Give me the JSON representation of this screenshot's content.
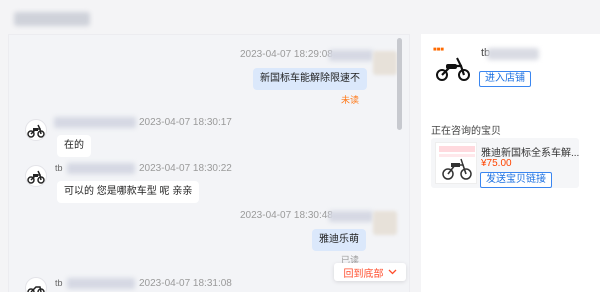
{
  "chat": {
    "messages": [
      {
        "time": "2023-04-07 18:29:08",
        "text": "新国标车能解除限速不",
        "status": "未读"
      },
      {
        "time": "2023-04-07 18:30:17",
        "text": "在的"
      },
      {
        "time": "2023-04-07 18:30:22",
        "nick_prefix": "tb",
        "text": "可以的 您是哪款车型 呢 亲亲"
      },
      {
        "time": "2023-04-07 18:30:48",
        "text": "雅迪乐萌",
        "status": "已读"
      },
      {
        "time": "2023-04-07 18:31:08",
        "nick_prefix": "tb"
      }
    ],
    "back_to_bottom_label": "回到底部"
  },
  "shop": {
    "name_prefix": "tb",
    "enter_shop_label": "进入店铺"
  },
  "consult": {
    "title": "正在咨询的宝贝",
    "product_title": "雅迪新国标全系车解...",
    "price": "¥75.00",
    "send_link_label": "发送宝贝链接"
  },
  "colors": {
    "accent_blue": "#1a6fe0",
    "unread_orange": "#ff7a1a",
    "price_red": "#ff4400",
    "out_bubble": "#dbe8fb"
  }
}
